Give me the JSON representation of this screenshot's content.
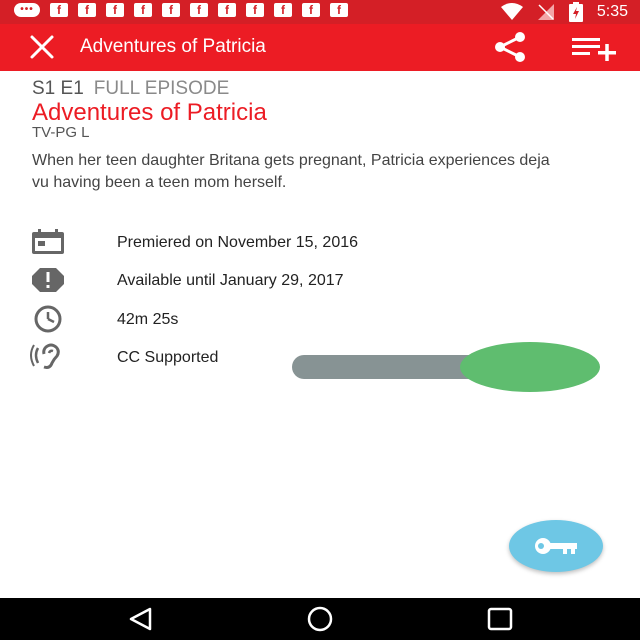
{
  "status_bar": {
    "time": "5:35",
    "notification_icons": [
      "messenger-icon",
      "facebook-icon",
      "facebook-icon",
      "facebook-icon",
      "facebook-icon",
      "facebook-icon",
      "facebook-icon",
      "facebook-icon",
      "facebook-icon",
      "facebook-icon",
      "facebook-icon"
    ]
  },
  "app_bar": {
    "title": "Adventures of Patricia",
    "background": "#ec1c24"
  },
  "episode": {
    "code": "S1 E1",
    "kind": "FULL EPISODE",
    "title": "Adventures of Patricia",
    "rating": "TV-PG L",
    "description": "When her teen daughter Britana gets pregnant, Patricia experiences deja vu having been a teen mom herself."
  },
  "info": {
    "premiered": "Premiered on November 15, 2016",
    "available": "Available until January 29, 2017",
    "duration": "42m 25s",
    "cc": "CC Supported"
  },
  "cc_toggle": {
    "on": true,
    "thumb_color": "#5fbd6f",
    "track_color": "#879394"
  },
  "fab": {
    "icon": "key-icon",
    "color": "#6ec7e5"
  }
}
